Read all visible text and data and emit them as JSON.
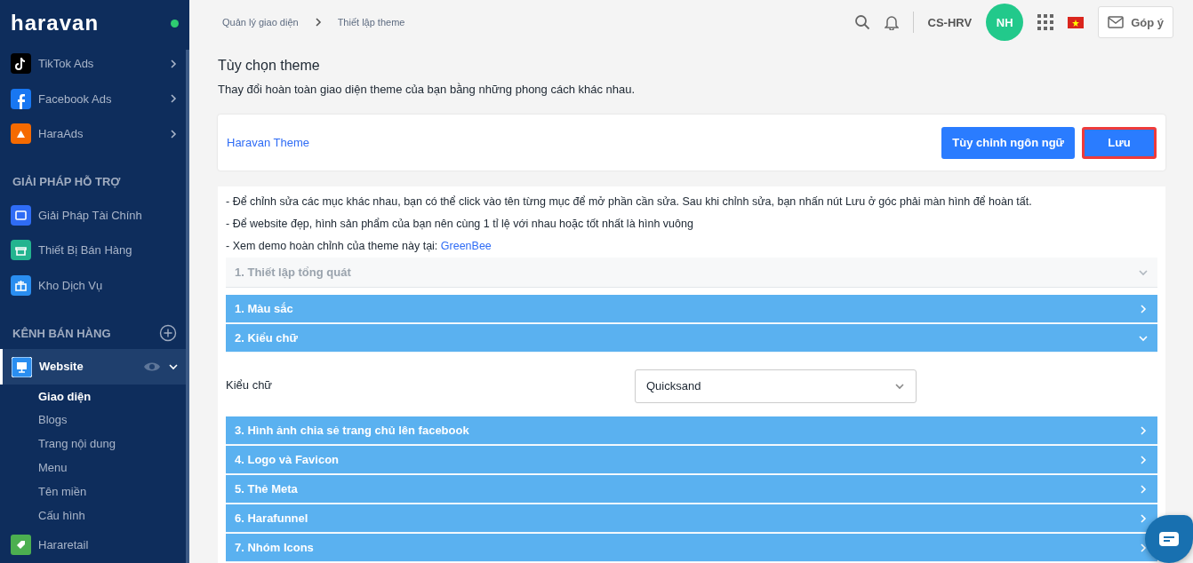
{
  "sidebar": {
    "logo": "haravan",
    "online": true,
    "items": [
      {
        "label": "TikTok Ads",
        "kind": "tiktok"
      },
      {
        "label": "Facebook Ads",
        "kind": "facebook"
      },
      {
        "label": "HaraAds",
        "kind": "haraads"
      }
    ],
    "sections": [
      {
        "title": "GIẢI PHÁP HỖ TRỢ",
        "can_add": false,
        "items": [
          {
            "label": "Giải Pháp Tài Chính",
            "kind": "finance",
            "selected": false
          },
          {
            "label": "Thiết Bị Bán Hàng",
            "kind": "store",
            "selected": false
          },
          {
            "label": "Kho Dịch Vụ",
            "kind": "gift",
            "selected": false
          }
        ]
      },
      {
        "title": "KÊNH BÁN HÀNG",
        "can_add": true,
        "items": [
          {
            "label": "Website",
            "kind": "website",
            "selected": true,
            "expanded": true,
            "children": [
              {
                "label": "Giao diện",
                "selected": true
              },
              {
                "label": "Blogs",
                "selected": false
              },
              {
                "label": "Trang nội dung",
                "selected": false
              },
              {
                "label": "Menu",
                "selected": false
              },
              {
                "label": "Tên miền",
                "selected": false
              },
              {
                "label": "Cấu hình",
                "selected": false
              }
            ]
          },
          {
            "label": "Hararetail",
            "kind": "tag",
            "selected": false
          }
        ]
      }
    ]
  },
  "topbar": {
    "breadcrumb": [
      "Quản lý giao diện",
      "Thiết lập theme"
    ],
    "store": "CS-HRV",
    "avatar": "NH",
    "feedback": "Góp ý"
  },
  "page": {
    "title": "Tùy chọn theme",
    "subtitle": "Thay đổi hoàn toàn giao diện theme của bạn bằng những phong cách khác nhau.",
    "theme_name": "Haravan Theme",
    "buttons": [
      {
        "label": "Tùy chỉnh ngôn ngữ",
        "highlighted": false
      },
      {
        "label": "Lưu",
        "highlighted": true
      }
    ],
    "notes": [
      {
        "text": "- Để chỉnh sửa các mục khác nhau, bạn có thể click vào tên từng mục để mở phần cần sửa. Sau khi chỉnh sửa, bạn nhấn nút Lưu ở góc phải màn hình để hoàn tất."
      },
      {
        "text": "- Để website đẹp, hình sản phẩm của bạn nên cùng 1 tỉ lệ với nhau hoặc tốt nhất là hình vuông"
      },
      {
        "text": "- Xem demo hoàn chỉnh của theme này tại: ",
        "link": "GreenBee"
      }
    ],
    "panels": [
      {
        "kind": "group",
        "title": "1. Thiết lập tổng quát",
        "expanded": true
      },
      {
        "kind": "section",
        "title": "1. Màu sắc",
        "expanded": false
      },
      {
        "kind": "section",
        "title": "2. Kiểu chữ",
        "expanded": true,
        "fields": [
          {
            "label": "Kiểu chữ",
            "value": "Quicksand"
          }
        ]
      },
      {
        "kind": "section",
        "title": "3. Hình ảnh chia sẻ trang chủ lên facebook",
        "expanded": false
      },
      {
        "kind": "section",
        "title": "4. Logo và Favicon",
        "expanded": false
      },
      {
        "kind": "section",
        "title": "5. Thẻ Meta",
        "expanded": false
      },
      {
        "kind": "section",
        "title": "6. Harafunnel",
        "expanded": false
      },
      {
        "kind": "section",
        "title": "7. Nhóm Icons",
        "expanded": false
      }
    ]
  }
}
